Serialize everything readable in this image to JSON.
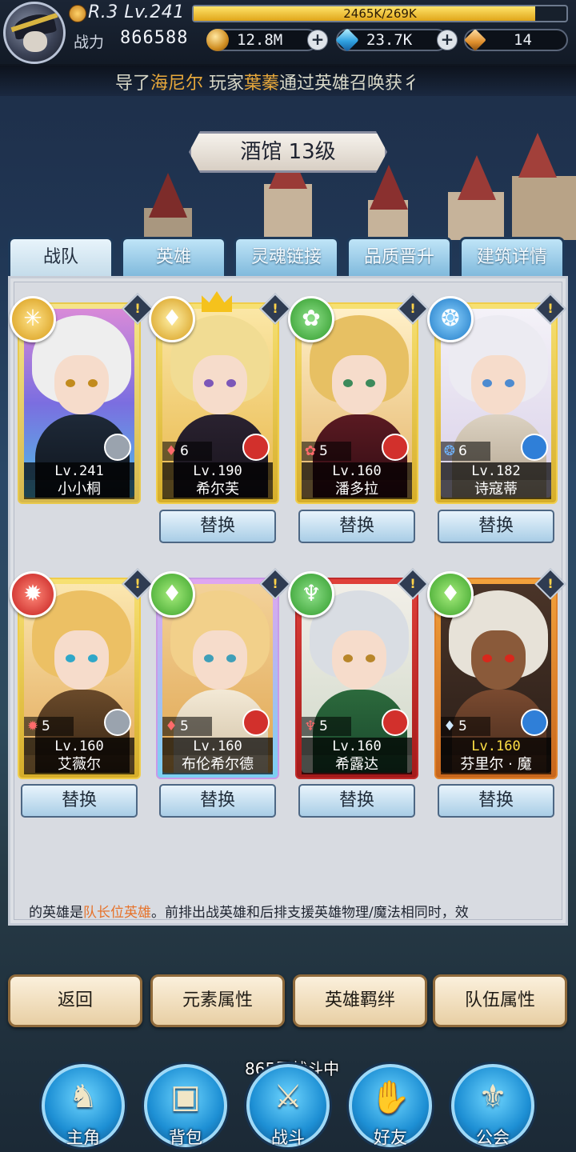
{
  "header": {
    "rank_level": "R.3 Lv.241",
    "exp_text": "2465K/269K",
    "exp_fraction": 0.916,
    "power_label": "战力",
    "power_value": "866588",
    "gold": "12.8M",
    "gems": "23.7K",
    "scrolls": "14"
  },
  "ticker": {
    "part1": "导了",
    "highlight1": "海尼尔",
    "part2": "   玩家",
    "highlight2": "葉蓁",
    "part3": "通过英雄召唤获彳"
  },
  "banner": {
    "title": "酒馆 13级"
  },
  "tabs": [
    "战队",
    "英雄",
    "灵魂链接",
    "品质晋升",
    "建筑详情"
  ],
  "heroes": [
    {
      "level": "Lv.241",
      "name": "小小桐",
      "stars": "",
      "element": "light-icon",
      "class": "mage-icon"
    },
    {
      "level": "Lv.190",
      "name": "希尔芙",
      "stars": "6",
      "element": "wind-icon",
      "class": "warrior-icon",
      "swap": "替换"
    },
    {
      "level": "Lv.160",
      "name": "潘多拉",
      "stars": "5",
      "element": "nature-icon",
      "class": "warrior-icon",
      "swap": "替换"
    },
    {
      "level": "Lv.182",
      "name": "诗寇蒂",
      "stars": "6",
      "element": "water-icon",
      "class": "mage-icon",
      "swap": "替换"
    },
    {
      "level": "Lv.160",
      "name": "艾薇尔",
      "stars": "5",
      "element": "fire-icon",
      "class": "knight-icon",
      "swap": "替换"
    },
    {
      "level": "Lv.160",
      "name": "布伦希尔德",
      "stars": "5",
      "element": "wind-icon",
      "class": "warrior-icon",
      "swap": "替换"
    },
    {
      "level": "Lv.160",
      "name": "希露达",
      "stars": "5",
      "element": "holy-icon",
      "class": "warrior-icon",
      "swap": "替换"
    },
    {
      "level": "Lv.160",
      "name": "芬里尔 · 魔",
      "stars": "5",
      "element": "wind-icon",
      "class": "mage-icon",
      "swap": "替换"
    }
  ],
  "hint": {
    "part1": "的英雄是",
    "highlight": "队长位英雄",
    "part2": "。前排出战英雄和后排支援英雄物理/魔法相同时，效"
  },
  "bottom_buttons": [
    "返回",
    "元素属性",
    "英雄羁绊",
    "队伍属性"
  ],
  "floor_status": "865层战斗中",
  "nav": [
    "主角",
    "背包",
    "战斗",
    "好友",
    "公会"
  ],
  "colors": {
    "accent_gold": "#e9a93b",
    "hint_highlight": "#e6722a",
    "nav_blue": "#1d8fd4"
  }
}
